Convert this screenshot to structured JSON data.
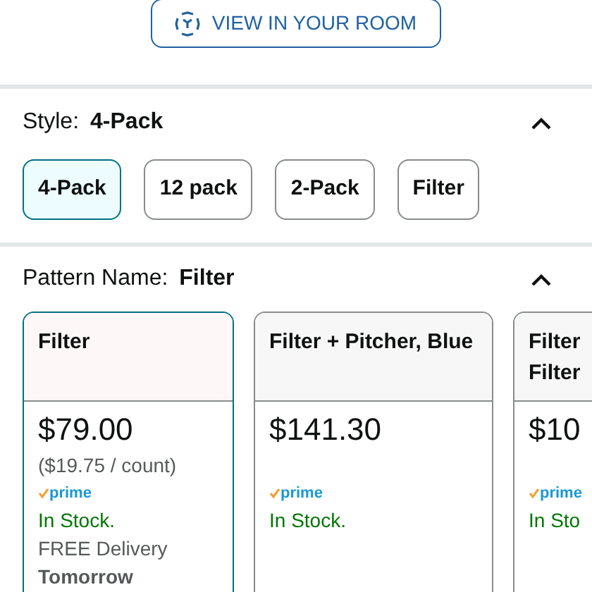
{
  "room_button": {
    "label": "VIEW IN YOUR ROOM"
  },
  "style": {
    "label": "Style:",
    "value": "4-Pack",
    "expanded": true,
    "options": [
      {
        "label": "4-Pack",
        "selected": true
      },
      {
        "label": "12 pack",
        "selected": false
      },
      {
        "label": "2-Pack",
        "selected": false
      },
      {
        "label": "Filter",
        "selected": false
      }
    ]
  },
  "pattern": {
    "label": "Pattern Name:",
    "value": "Filter",
    "expanded": true,
    "cards": [
      {
        "title_lines": [
          "Filter"
        ],
        "selected": true,
        "price": "$79.00",
        "unit_price": "($19.75 / count)",
        "prime": "prime",
        "stock": "In Stock.",
        "delivery": "FREE Delivery",
        "delivery_day": "Tomorrow"
      },
      {
        "title_lines": [
          "Filter + Pitcher, Blue"
        ],
        "selected": false,
        "price": "$141.30",
        "prime": "prime",
        "stock": "In Stock."
      },
      {
        "title_lines": [
          "Filter",
          "Filter"
        ],
        "selected": false,
        "price": "$10",
        "prime": "prime",
        "stock": "In Sto"
      }
    ]
  }
}
